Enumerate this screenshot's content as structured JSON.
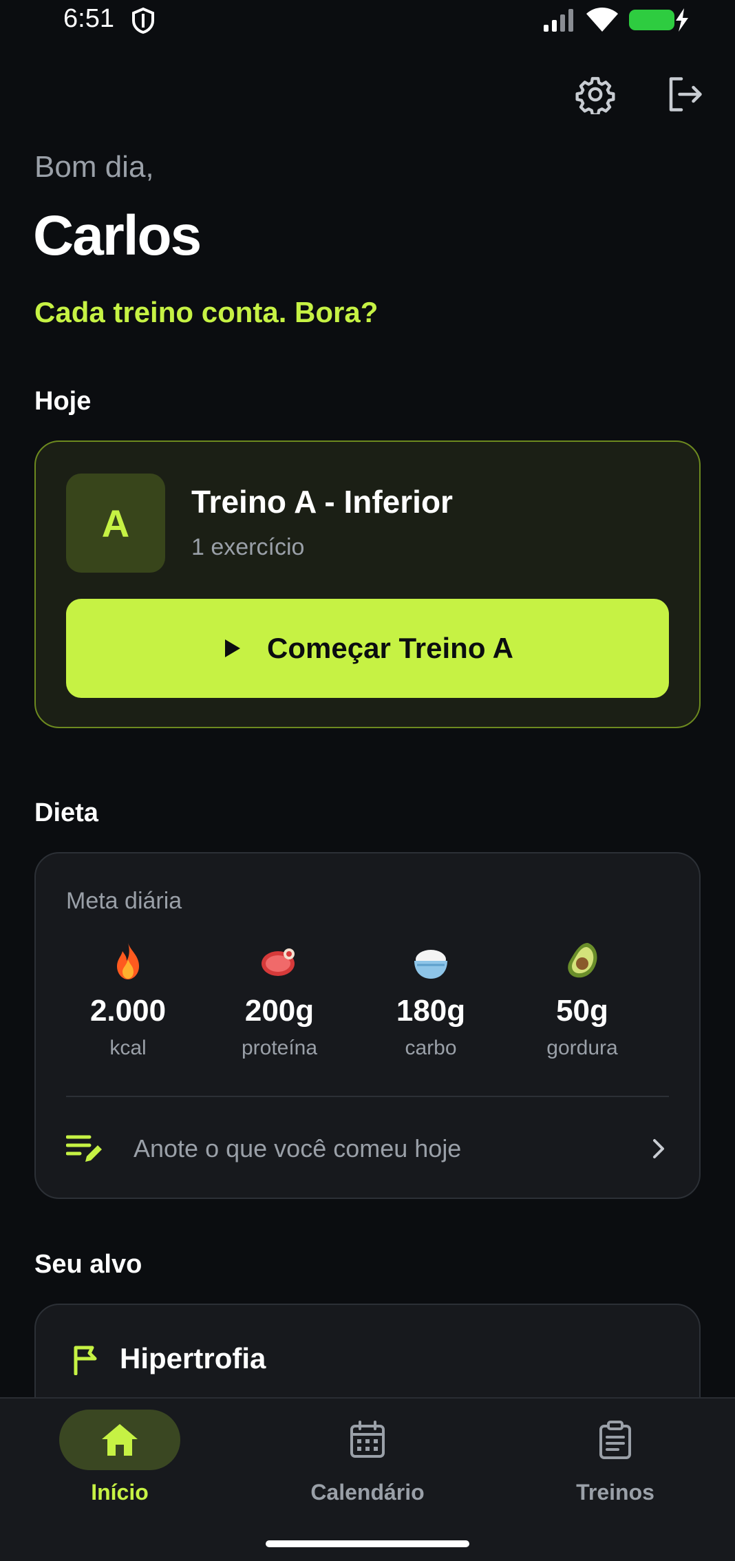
{
  "status_bar": {
    "time": "6:51"
  },
  "header": {
    "greeting": "Bom dia,",
    "user_name": "Carlos",
    "motivation": "Cada treino conta. Bora?"
  },
  "today": {
    "section_title": "Hoje",
    "badge_letter": "A",
    "workout_name": "Treino A - Inferior",
    "exercise_count": "1 exercício",
    "start_button_label": "Começar Treino A"
  },
  "diet": {
    "section_title": "Dieta",
    "subtitle": "Meta diária",
    "macros": [
      {
        "icon": "fire-icon",
        "value": "2.000",
        "unit": "kcal"
      },
      {
        "icon": "meat-icon",
        "value": "200g",
        "unit": "proteína"
      },
      {
        "icon": "rice-bowl-icon",
        "value": "180g",
        "unit": "carbo"
      },
      {
        "icon": "avocado-icon",
        "value": "50g",
        "unit": "gordura"
      }
    ],
    "log_prompt": "Anote o que você comeu hoje"
  },
  "goal": {
    "section_title": "Seu alvo",
    "goal_name": "Hipertrofia"
  },
  "bottom_nav": {
    "items": [
      {
        "label": "Início",
        "icon": "home-icon",
        "active": true
      },
      {
        "label": "Calendário",
        "icon": "calendar-icon",
        "active": false
      },
      {
        "label": "Treinos",
        "icon": "clipboard-icon",
        "active": false
      }
    ]
  },
  "colors": {
    "accent": "#c6f244",
    "background": "#0b0d10",
    "card": "#17191d",
    "muted_text": "#9aa0a8"
  }
}
